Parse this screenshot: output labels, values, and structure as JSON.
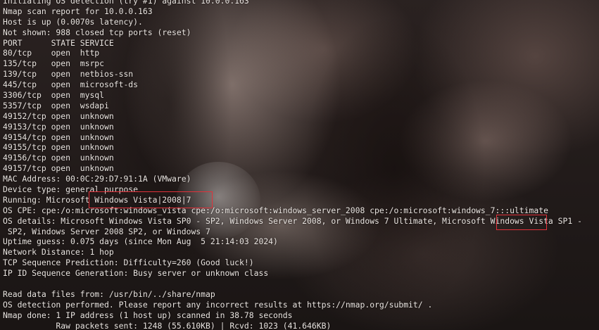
{
  "terminal": {
    "lines": [
      "Initiating OS detection (try #1) against 10.0.0.163",
      "Nmap scan report for 10.0.0.163",
      "Host is up (0.0070s latency).",
      "Not shown: 988 closed tcp ports (reset)",
      "PORT      STATE SERVICE",
      "80/tcp    open  http",
      "135/tcp   open  msrpc",
      "139/tcp   open  netbios-ssn",
      "445/tcp   open  microsoft-ds",
      "3306/tcp  open  mysql",
      "5357/tcp  open  wsdapi",
      "49152/tcp open  unknown",
      "49153/tcp open  unknown",
      "49154/tcp open  unknown",
      "49155/tcp open  unknown",
      "49156/tcp open  unknown",
      "49157/tcp open  unknown",
      "MAC Address: 00:0C:29:D7:91:1A (VMware)",
      "Device type: general purpose",
      "Running: Microsoft Windows Vista|2008|7",
      "OS CPE: cpe:/o:microsoft:windows_vista cpe:/o:microsoft:windows_server_2008 cpe:/o:microsoft:windows_7:::ultimate",
      "OS details: Microsoft Windows Vista SP0 - SP2, Windows Server 2008, or Windows 7 Ultimate, Microsoft Windows Vista SP1 -",
      " SP2, Windows Server 2008 SP2, or Windows 7",
      "Uptime guess: 0.075 days (since Mon Aug  5 21:14:03 2024)",
      "Network Distance: 1 hop",
      "TCP Sequence Prediction: Difficulty=260 (Good luck!)",
      "IP ID Sequence Generation: Busy server or unknown class",
      "",
      "Read data files from: /usr/bin/../share/nmap",
      "OS detection performed. Please report any incorrect results at https://nmap.org/submit/ .",
      "Nmap done: 1 IP address (1 host up) scanned in 38.78 seconds",
      "           Raw packets sent: 1248 (55.610KB) | Rcvd: 1023 (41.646KB)"
    ]
  },
  "highlight_color": "#e0313a"
}
